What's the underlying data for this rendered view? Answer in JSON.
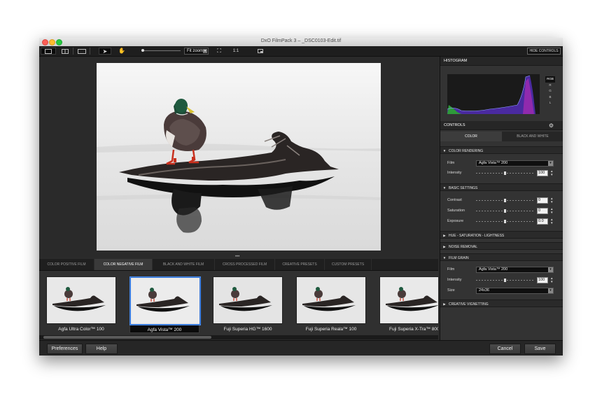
{
  "window": {
    "title": "DxO FilmPack 3 – _DSC0103-Edit.tif"
  },
  "toolbar": {
    "zoom_value": "Fit zoom",
    "actual_size_label": "1:1",
    "hide_controls_label": "HIDE CONTROLS"
  },
  "film_tabs": [
    {
      "label": "COLOR POSITIVE FILM"
    },
    {
      "label": "COLOR NEGATIVE FILM"
    },
    {
      "label": "BLACK AND WHITE FILM"
    },
    {
      "label": "CROSS PROCESSED FILM"
    },
    {
      "label": "CREATIVE PRESETS"
    },
    {
      "label": "CUSTOM PRESETS"
    }
  ],
  "active_film_tab": "COLOR NEGATIVE FILM",
  "thumbnails": [
    {
      "label": "Agfa Ultra Color™ 100"
    },
    {
      "label": "Agfa Vista™ 200"
    },
    {
      "label": "Fuji Superia HG™ 1600"
    },
    {
      "label": "Fuji Superia Reala™ 100"
    },
    {
      "label": "Fuji Superia X-Tra™ 800"
    }
  ],
  "selected_thumbnail": "Agfa Vista™ 200",
  "bottom": {
    "preferences_label": "Preferences",
    "help_label": "Help",
    "cancel_label": "Cancel",
    "save_label": "Save"
  },
  "panel": {
    "histogram_title": "HISTOGRAM",
    "channels": [
      "RGB",
      "R",
      "G",
      "B",
      "L"
    ],
    "active_channel": "RGB",
    "controls_title": "CONTROLS",
    "tabs": [
      {
        "label": "COLOR"
      },
      {
        "label": "BLACK AND WHITE"
      }
    ],
    "active_tab": "COLOR",
    "color_rendering": {
      "title": "COLOR RENDERING",
      "film_label": "Film",
      "film_value": "Agfa Vista™ 200",
      "intensity_label": "Intensity",
      "intensity_value": "100",
      "intensity_level": 0.5
    },
    "basic_settings": {
      "title": "BASIC SETTINGS",
      "contrast_label": "Contrast",
      "contrast_value": "0",
      "saturation_label": "Saturation",
      "saturation_value": "0",
      "exposure_label": "Exposure",
      "exposure_value": "0.0"
    },
    "hsl_title": "HUE - SATURATION - LIGHTNESS",
    "noise_title": "NOISE REMOVAL",
    "film_grain": {
      "title": "FILM GRAIN",
      "film_label": "Film",
      "film_value": "Agfa Vista™ 200",
      "intensity_label": "Intensity",
      "intensity_value": "100",
      "size_label": "Size",
      "size_value": "24x36"
    },
    "vignetting_title": "CREATIVE VIGNETTING"
  },
  "colors": {
    "accent": "#4a8ef0",
    "panel_bg": "#333333",
    "toolbar_bg": "#1e1e1e"
  }
}
